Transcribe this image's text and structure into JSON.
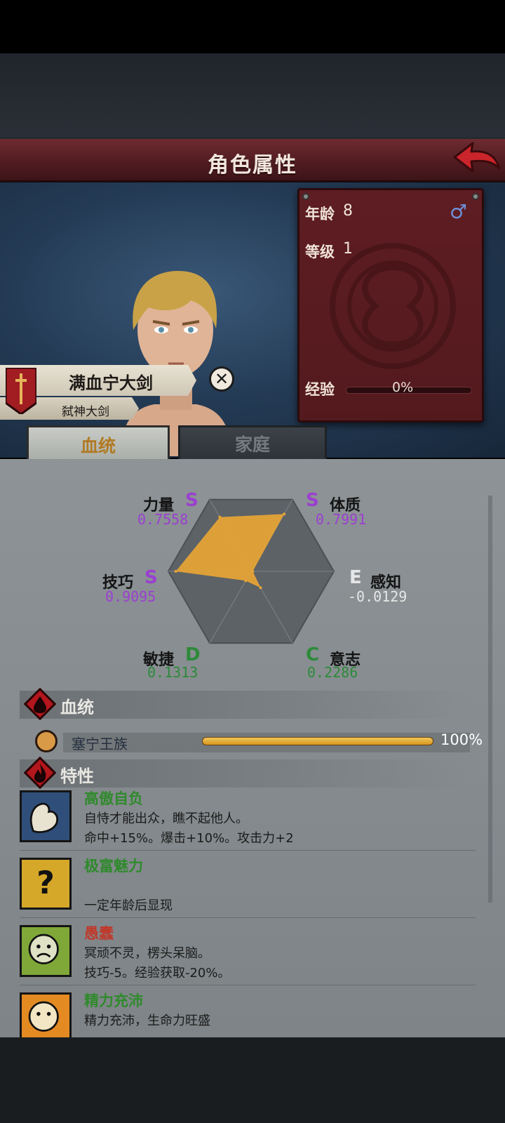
{
  "header": {
    "title": "角色属性"
  },
  "info": {
    "age_label": "年龄",
    "age_value": "8",
    "level_label": "等级",
    "level_value": "1",
    "exp_label": "经验",
    "exp_value": "0%",
    "gender_icon": "male-icon",
    "exp_fraction": 0
  },
  "character": {
    "name": "满血宁大剑",
    "subtitle": "弑神大剑"
  },
  "tabs": [
    {
      "label": "血统",
      "active": true
    },
    {
      "label": "家庭",
      "active": false
    }
  ],
  "stats": [
    {
      "name": "力量",
      "grade": "S",
      "value": "0.7558",
      "color": "#9b3fd1"
    },
    {
      "name": "体质",
      "grade": "S",
      "value": "0.7991",
      "color": "#9b3fd1"
    },
    {
      "name": "感知",
      "grade": "E",
      "value": "-0.0129",
      "color": "#e6e6e6"
    },
    {
      "name": "意志",
      "grade": "C",
      "value": "0.2286",
      "color": "#2d8a3a"
    },
    {
      "name": "敏捷",
      "grade": "D",
      "value": "0.1313",
      "color": "#2d8a3a"
    },
    {
      "name": "技巧",
      "grade": "S",
      "value": "0.9095",
      "color": "#9b3fd1"
    }
  ],
  "radar": {
    "values": [
      0.7558,
      0.7991,
      -0.0129,
      0.2286,
      0.1313,
      0.9095
    ],
    "fill_color": "#e8a535"
  },
  "bloodline_section": {
    "title": "血统",
    "entry": {
      "name": "塞宁王族",
      "percent": "100%",
      "fraction": 1.0
    }
  },
  "traits_section": {
    "title": "特性",
    "items": [
      {
        "name": "高傲自负",
        "desc": "自恃才能出众，瞧不起他人。",
        "effect": "命中+15%。爆击+10%。攻击力+2",
        "name_color": "#2f8a2c",
        "icon": "flexed-arm-icon"
      },
      {
        "name": "极富魅力",
        "desc": "",
        "effect": "一定年龄后显现",
        "name_color": "#2f8a2c",
        "icon": "question-mark-icon"
      },
      {
        "name": "愚蠢",
        "desc": "冥顽不灵，楞头呆脑。",
        "effect": "技巧-5。经验获取-20%。",
        "name_color": "#c0392b",
        "icon": "sad-face-icon"
      },
      {
        "name": "精力充沛",
        "desc": "精力充沛，生命力旺盛",
        "effect": "",
        "name_color": "#2f8a2c",
        "icon": "sun-face-icon"
      }
    ]
  }
}
